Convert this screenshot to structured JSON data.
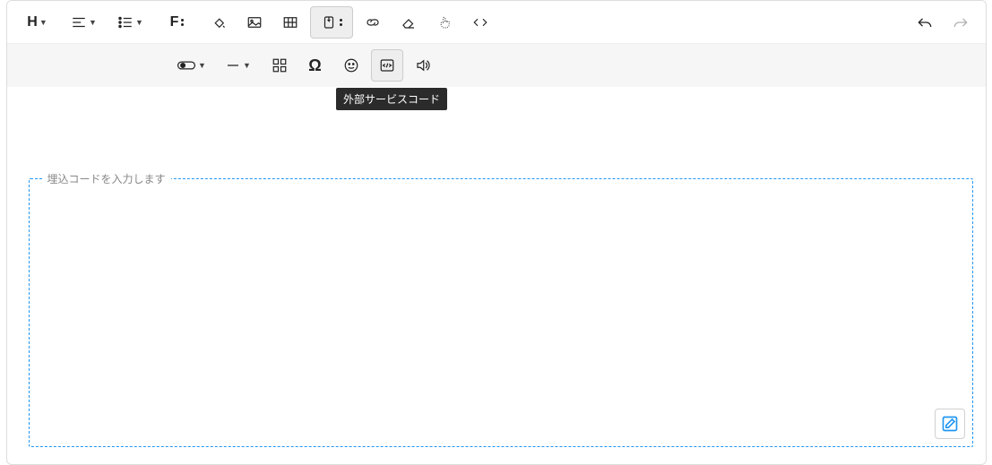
{
  "toolbar": {
    "heading_label": "H",
    "font_label": "F",
    "omega_label": "Ω",
    "tooltip_embed": "外部サービスコード"
  },
  "editor": {
    "embed_placeholder_label": "埋込コードを入力します"
  }
}
